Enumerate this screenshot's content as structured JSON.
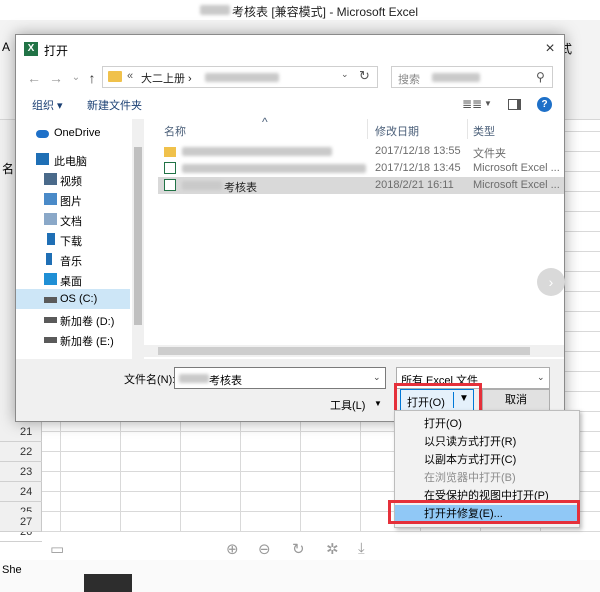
{
  "excel": {
    "title": "考核表 [兼容模式] - Microsoft Excel",
    "left_text_1": "A",
    "left_text_2": "名",
    "left_text_3": "She",
    "right_text": "式",
    "row_numbers": [
      "21",
      "22",
      "23",
      "24",
      "25",
      "26",
      "27"
    ]
  },
  "dialog": {
    "title": "打开",
    "nav": {
      "back": "←",
      "forward": "→",
      "dropdown": "⌄",
      "up": "↑",
      "address_chevron": "«",
      "address_path": "大二上册  ›",
      "address_dropdown": "⌄",
      "refresh": "↻",
      "search_placeholder": "搜索",
      "search_icon": "⚲"
    },
    "commands": {
      "organize": "组织 ▾",
      "new_folder": "新建文件夹",
      "view_icon": "≣≣",
      "view_dropdown": "▼",
      "help": "?"
    },
    "nav_pane": [
      {
        "label": "OneDrive",
        "icon": "cloud-icon",
        "color": "#1e70c8"
      },
      {
        "label": "此电脑",
        "icon": "computer-icon",
        "color": "#1f6fb5"
      },
      {
        "label": "视频",
        "icon": "video-icon",
        "color": "#4a6a8a"
      },
      {
        "label": "图片",
        "icon": "picture-icon",
        "color": "#4a8ac8"
      },
      {
        "label": "文档",
        "icon": "document-icon",
        "color": "#8aa8c8"
      },
      {
        "label": "下载",
        "icon": "download-icon",
        "color": "#1f6fb5"
      },
      {
        "label": "音乐",
        "icon": "music-icon",
        "color": "#1f6fb5"
      },
      {
        "label": "桌面",
        "icon": "desktop-icon",
        "color": "#1f8fd5"
      },
      {
        "label": "OS (C:)",
        "icon": "drive-icon",
        "color": "#5a5a5a"
      },
      {
        "label": "新加卷 (D:)",
        "icon": "drive-icon",
        "color": "#5a5a5a"
      },
      {
        "label": "新加卷 (E:)",
        "icon": "drive-icon",
        "color": "#5a5a5a"
      }
    ],
    "columns": {
      "name": "名称",
      "modified": "修改日期",
      "type": "类型",
      "sort_indicator": "^"
    },
    "files": [
      {
        "name": "",
        "date": "2017/12/18 13:55",
        "type": "文件夹",
        "icon": "folder-icon"
      },
      {
        "name": "",
        "date": "2017/12/18 13:45",
        "type": "Microsoft Excel ...",
        "icon": "excel-file-icon"
      },
      {
        "name": "考核表",
        "date": "2018/2/21 16:11",
        "type": "Microsoft Excel ...",
        "icon": "excel-file-icon"
      }
    ],
    "filename_label": "文件名(N):",
    "filename_value": "考核表",
    "filetype_value": "所有 Excel 文件",
    "tools_label": "工具(L)",
    "open_label": "打开(O)",
    "cancel_label": "取消",
    "close_glyph": "×",
    "dd_glyph": "⌄",
    "small_dd": "▼"
  },
  "open_menu": [
    {
      "label": "打开(O)",
      "enabled": true
    },
    {
      "label": "以只读方式打开(R)",
      "enabled": true
    },
    {
      "label": "以副本方式打开(C)",
      "enabled": true
    },
    {
      "label": "在浏览器中打开(B)",
      "enabled": false
    },
    {
      "label": "在受保护的视图中打开(P)",
      "enabled": true
    },
    {
      "label": "打开并修复(E)...",
      "enabled": true,
      "highlighted": true
    }
  ],
  "viewer_toolbar": {
    "save": "▭",
    "zoom_in": "⊕",
    "zoom_out": "⊖",
    "rotate": "↻",
    "magic": "✲",
    "download": "⤓",
    "next": "›"
  },
  "colors": {
    "highlight_box": "#e5303a",
    "menu_highlight": "#90c8f6",
    "accent": "#0078d7"
  }
}
